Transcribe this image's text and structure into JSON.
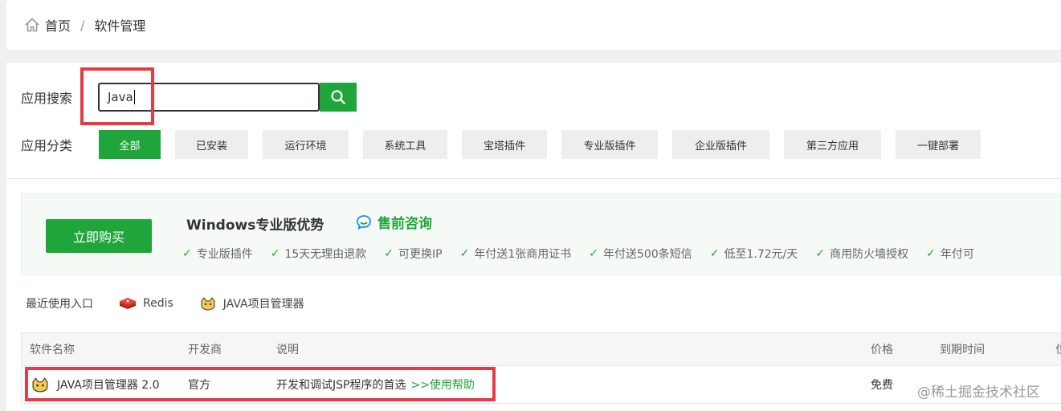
{
  "breadcrumb": {
    "home": "首页",
    "separator": "/",
    "current": "软件管理"
  },
  "search": {
    "label": "应用搜索",
    "value": "Java"
  },
  "categories": {
    "label": "应用分类",
    "items": [
      "全部",
      "已安装",
      "运行环境",
      "系统工具",
      "宝塔插件",
      "专业版插件",
      "企业版插件",
      "第三方应用",
      "一键部署"
    ]
  },
  "promo": {
    "buy_label": "立即购买",
    "title": "Windows专业版优势",
    "consult": "售前咨询",
    "features": [
      "专业版插件",
      "15天无理由退款",
      "可更换IP",
      "年付送1张商用证书",
      "年付送500条短信",
      "低至1.72元/天",
      "商用防火墙授权",
      "年付可"
    ]
  },
  "recent": {
    "label": "最近使用入口",
    "items": [
      "Redis",
      "JAVA项目管理器"
    ]
  },
  "table": {
    "headers": [
      "软件名称",
      "开发商",
      "说明",
      "价格",
      "到期时间",
      "位"
    ],
    "rows": [
      {
        "name": "JAVA项目管理器 2.0",
        "developer": "官方",
        "description": "开发和调试JSP程序的首选",
        "help": ">>使用帮助",
        "price": "免费"
      }
    ]
  },
  "watermark": "@稀土掘金技术社区",
  "colors": {
    "accent": "#20a53a",
    "highlight": "#e63a46"
  }
}
